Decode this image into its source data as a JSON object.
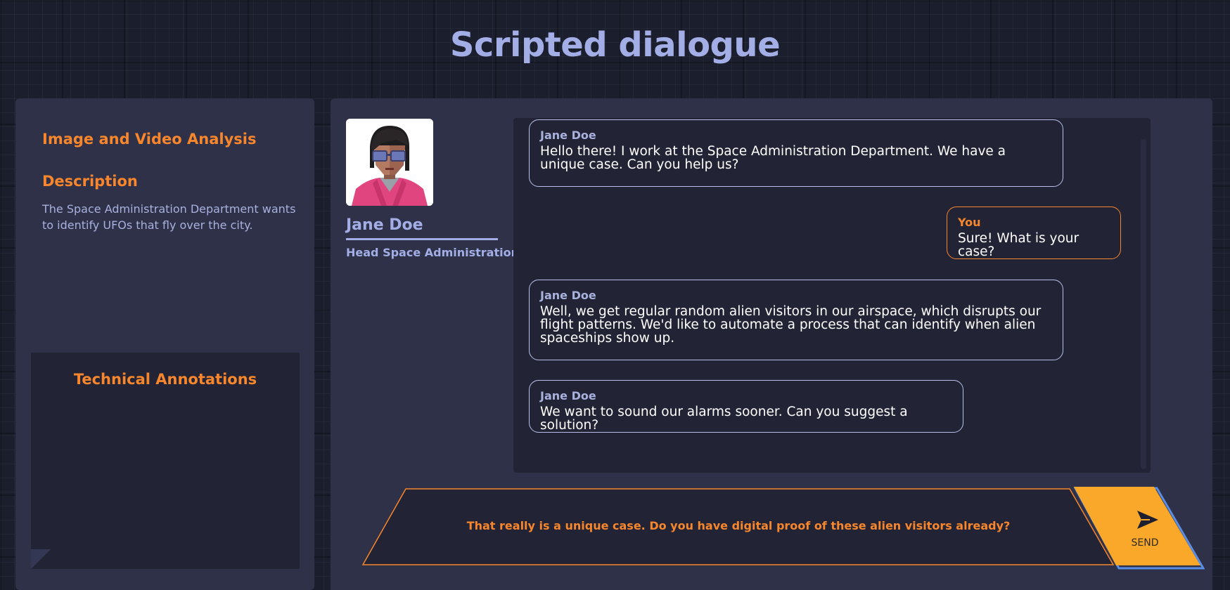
{
  "page": {
    "title": "Scripted dialogue"
  },
  "activity": {
    "title": "Image and Video Analysis",
    "description_heading": "Description",
    "description": "The Space Administration Department wants to identify UFOs that fly over the city.",
    "annotations_heading": "Technical Annotations"
  },
  "character": {
    "name": "Jane Doe",
    "role": "Head Space Administration"
  },
  "messages": [
    {
      "speaker": "Jane Doe",
      "text": "Hello there! I work at the Space Administration Department. We have a unique case. Can you help us?"
    },
    {
      "speaker": "You",
      "text": "Sure! What is your case?"
    },
    {
      "speaker": "Jane Doe",
      "text": "Well, we get regular random alien visitors in our airspace, which disrupts our flight patterns. We'd like to automate a process that can identify when alien spaceships show up."
    },
    {
      "speaker": "Jane Doe",
      "text": "We want to sound our alarms sooner. Can you suggest a solution?"
    }
  ],
  "reply": {
    "option_text": "That really is a unique case. Do you have digital proof of these alien visitors already?",
    "send_label": "SEND",
    "send_icon": "send-arrow-icon"
  },
  "colors": {
    "accent_orange": "#f7862c",
    "title_lavender": "#a4aee6",
    "send_yellow": "#f9a82a",
    "panel_bg": "#2e3148",
    "chat_bg": "#222436"
  }
}
